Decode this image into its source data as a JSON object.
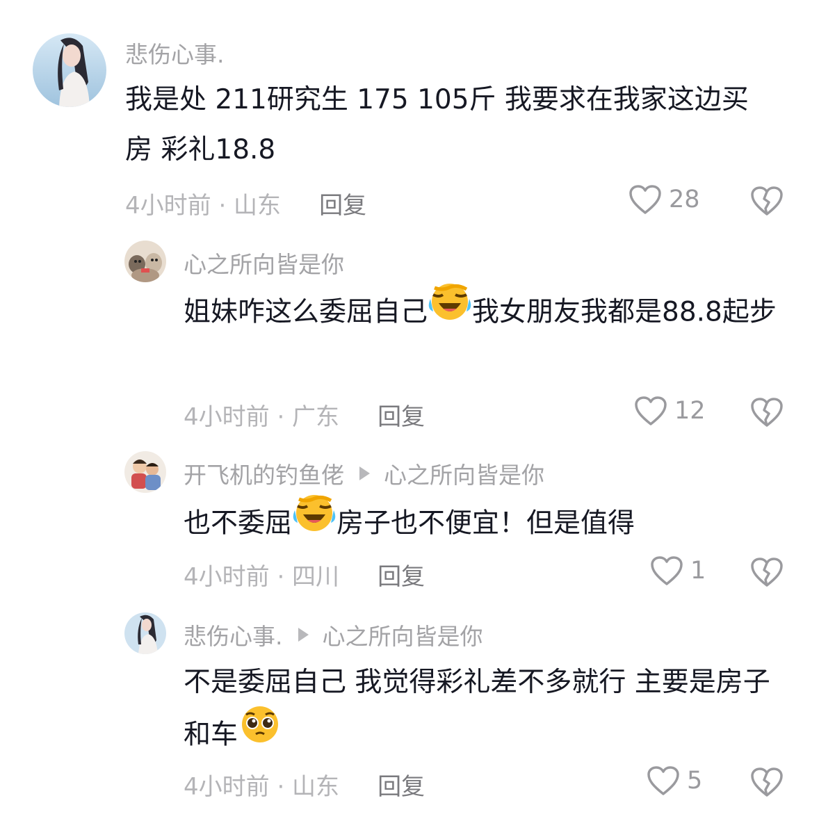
{
  "comments": [
    {
      "username": "悲伤心事.",
      "text": "我是处 211研究生 175 105斤 我要求在我家这边买房 彩礼18.8",
      "time_location": "4小时前 · 山东",
      "reply_label": "回复",
      "likes": "28"
    },
    {
      "username": "心之所向皆是你",
      "text_before_emoji": "姐妹咋这么委屈自己",
      "emoji": "crying-laughing-face",
      "text_after_emoji": "我女朋友我都是88.8起步",
      "time_location": "4小时前 · 广东",
      "reply_label": "回复",
      "likes": "12"
    },
    {
      "username": "开飞机的钓鱼佬",
      "reply_to": "心之所向皆是你",
      "text_before_emoji": "也不委屈",
      "emoji": "crying-laughing-face",
      "text_after_emoji": "房子也不便宜！但是值得",
      "time_location": "4小时前 · 四川",
      "reply_label": "回复",
      "likes": "1"
    },
    {
      "username": "悲伤心事.",
      "reply_to": "心之所向皆是你",
      "text_before_emoji": "不是委屈自己 我觉得彩礼差不多就行 主要是房子和车",
      "emoji": "pleading-face",
      "time_location": "4小时前 · 山东",
      "reply_label": "回复",
      "likes": "5"
    }
  ],
  "icons": {
    "like": "heart-outline-icon",
    "dislike": "broken-heart-icon",
    "reply_arrow": "triangle-right-icon"
  },
  "colors": {
    "username": "#a3a3a6",
    "text": "#161823",
    "meta": "#b4b4b7",
    "reply": "#7a7a7e",
    "icon": "#9a9a9e"
  },
  "watermark": ""
}
